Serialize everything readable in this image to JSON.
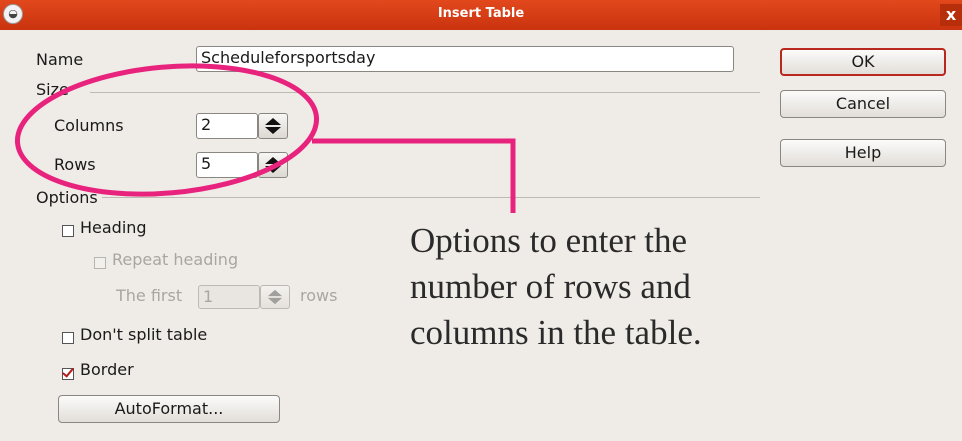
{
  "window": {
    "title": "Insert Table",
    "close": "x"
  },
  "name": {
    "label": "Name",
    "value": "Scheduleforsportsday"
  },
  "size": {
    "section_label": "Size",
    "columns": {
      "label": "Columns",
      "value": "2"
    },
    "rows": {
      "label": "Rows",
      "value": "5"
    }
  },
  "options": {
    "section_label": "Options",
    "heading": {
      "label": "Heading",
      "checked": false
    },
    "repeat_heading": {
      "label": "Repeat heading",
      "checked": false,
      "enabled": false
    },
    "the_first": {
      "label": "The first",
      "value": "1",
      "suffix": "rows",
      "enabled": false
    },
    "dont_split": {
      "label": "Don't split table",
      "checked": false
    },
    "border": {
      "label": "Border",
      "checked": true
    },
    "autoformat": {
      "label": "AutoFormat..."
    }
  },
  "buttons": {
    "ok": "OK",
    "cancel": "Cancel",
    "help": "Help"
  },
  "annotation": {
    "lines": [
      "Options to enter the",
      "number of rows and",
      "columns in the table."
    ],
    "highlight_color": "#e8237d"
  }
}
